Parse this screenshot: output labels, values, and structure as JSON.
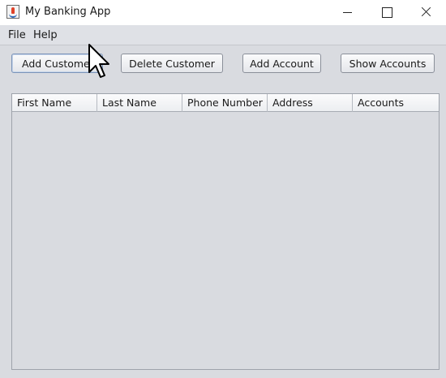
{
  "window": {
    "title": "My Banking App",
    "icon": "java-icon"
  },
  "menu": {
    "items": [
      {
        "label": "File"
      },
      {
        "label": "Help"
      }
    ]
  },
  "toolbar": {
    "add_customer_label": "Add Custome",
    "delete_customer_label": "Delete Customer",
    "add_account_label": "Add Account",
    "show_accounts_label": "Show Accounts"
  },
  "table": {
    "columns": [
      "First Name",
      "Last Name",
      "Phone Number",
      "Address",
      "Accounts"
    ],
    "rows": []
  },
  "cursor": {
    "icon": "arrow-cursor-icon"
  }
}
